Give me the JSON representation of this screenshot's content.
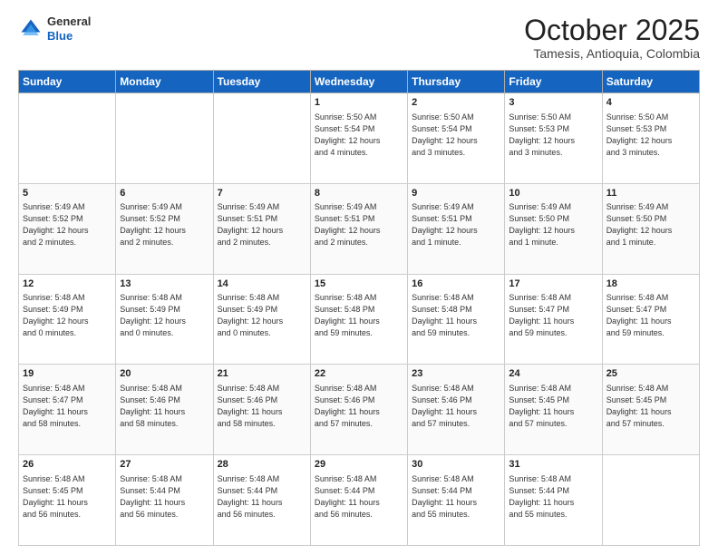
{
  "header": {
    "logo": {
      "general": "General",
      "blue": "Blue"
    },
    "title": "October 2025",
    "location": "Tamesis, Antioquia, Colombia"
  },
  "days_of_week": [
    "Sunday",
    "Monday",
    "Tuesday",
    "Wednesday",
    "Thursday",
    "Friday",
    "Saturday"
  ],
  "weeks": [
    [
      {
        "day": "",
        "content": ""
      },
      {
        "day": "",
        "content": ""
      },
      {
        "day": "",
        "content": ""
      },
      {
        "day": "1",
        "content": "Sunrise: 5:50 AM\nSunset: 5:54 PM\nDaylight: 12 hours\nand 4 minutes."
      },
      {
        "day": "2",
        "content": "Sunrise: 5:50 AM\nSunset: 5:54 PM\nDaylight: 12 hours\nand 3 minutes."
      },
      {
        "day": "3",
        "content": "Sunrise: 5:50 AM\nSunset: 5:53 PM\nDaylight: 12 hours\nand 3 minutes."
      },
      {
        "day": "4",
        "content": "Sunrise: 5:50 AM\nSunset: 5:53 PM\nDaylight: 12 hours\nand 3 minutes."
      }
    ],
    [
      {
        "day": "5",
        "content": "Sunrise: 5:49 AM\nSunset: 5:52 PM\nDaylight: 12 hours\nand 2 minutes."
      },
      {
        "day": "6",
        "content": "Sunrise: 5:49 AM\nSunset: 5:52 PM\nDaylight: 12 hours\nand 2 minutes."
      },
      {
        "day": "7",
        "content": "Sunrise: 5:49 AM\nSunset: 5:51 PM\nDaylight: 12 hours\nand 2 minutes."
      },
      {
        "day": "8",
        "content": "Sunrise: 5:49 AM\nSunset: 5:51 PM\nDaylight: 12 hours\nand 2 minutes."
      },
      {
        "day": "9",
        "content": "Sunrise: 5:49 AM\nSunset: 5:51 PM\nDaylight: 12 hours\nand 1 minute."
      },
      {
        "day": "10",
        "content": "Sunrise: 5:49 AM\nSunset: 5:50 PM\nDaylight: 12 hours\nand 1 minute."
      },
      {
        "day": "11",
        "content": "Sunrise: 5:49 AM\nSunset: 5:50 PM\nDaylight: 12 hours\nand 1 minute."
      }
    ],
    [
      {
        "day": "12",
        "content": "Sunrise: 5:48 AM\nSunset: 5:49 PM\nDaylight: 12 hours\nand 0 minutes."
      },
      {
        "day": "13",
        "content": "Sunrise: 5:48 AM\nSunset: 5:49 PM\nDaylight: 12 hours\nand 0 minutes."
      },
      {
        "day": "14",
        "content": "Sunrise: 5:48 AM\nSunset: 5:49 PM\nDaylight: 12 hours\nand 0 minutes."
      },
      {
        "day": "15",
        "content": "Sunrise: 5:48 AM\nSunset: 5:48 PM\nDaylight: 11 hours\nand 59 minutes."
      },
      {
        "day": "16",
        "content": "Sunrise: 5:48 AM\nSunset: 5:48 PM\nDaylight: 11 hours\nand 59 minutes."
      },
      {
        "day": "17",
        "content": "Sunrise: 5:48 AM\nSunset: 5:47 PM\nDaylight: 11 hours\nand 59 minutes."
      },
      {
        "day": "18",
        "content": "Sunrise: 5:48 AM\nSunset: 5:47 PM\nDaylight: 11 hours\nand 59 minutes."
      }
    ],
    [
      {
        "day": "19",
        "content": "Sunrise: 5:48 AM\nSunset: 5:47 PM\nDaylight: 11 hours\nand 58 minutes."
      },
      {
        "day": "20",
        "content": "Sunrise: 5:48 AM\nSunset: 5:46 PM\nDaylight: 11 hours\nand 58 minutes."
      },
      {
        "day": "21",
        "content": "Sunrise: 5:48 AM\nSunset: 5:46 PM\nDaylight: 11 hours\nand 58 minutes."
      },
      {
        "day": "22",
        "content": "Sunrise: 5:48 AM\nSunset: 5:46 PM\nDaylight: 11 hours\nand 57 minutes."
      },
      {
        "day": "23",
        "content": "Sunrise: 5:48 AM\nSunset: 5:46 PM\nDaylight: 11 hours\nand 57 minutes."
      },
      {
        "day": "24",
        "content": "Sunrise: 5:48 AM\nSunset: 5:45 PM\nDaylight: 11 hours\nand 57 minutes."
      },
      {
        "day": "25",
        "content": "Sunrise: 5:48 AM\nSunset: 5:45 PM\nDaylight: 11 hours\nand 57 minutes."
      }
    ],
    [
      {
        "day": "26",
        "content": "Sunrise: 5:48 AM\nSunset: 5:45 PM\nDaylight: 11 hours\nand 56 minutes."
      },
      {
        "day": "27",
        "content": "Sunrise: 5:48 AM\nSunset: 5:44 PM\nDaylight: 11 hours\nand 56 minutes."
      },
      {
        "day": "28",
        "content": "Sunrise: 5:48 AM\nSunset: 5:44 PM\nDaylight: 11 hours\nand 56 minutes."
      },
      {
        "day": "29",
        "content": "Sunrise: 5:48 AM\nSunset: 5:44 PM\nDaylight: 11 hours\nand 56 minutes."
      },
      {
        "day": "30",
        "content": "Sunrise: 5:48 AM\nSunset: 5:44 PM\nDaylight: 11 hours\nand 55 minutes."
      },
      {
        "day": "31",
        "content": "Sunrise: 5:48 AM\nSunset: 5:44 PM\nDaylight: 11 hours\nand 55 minutes."
      },
      {
        "day": "",
        "content": ""
      }
    ]
  ]
}
